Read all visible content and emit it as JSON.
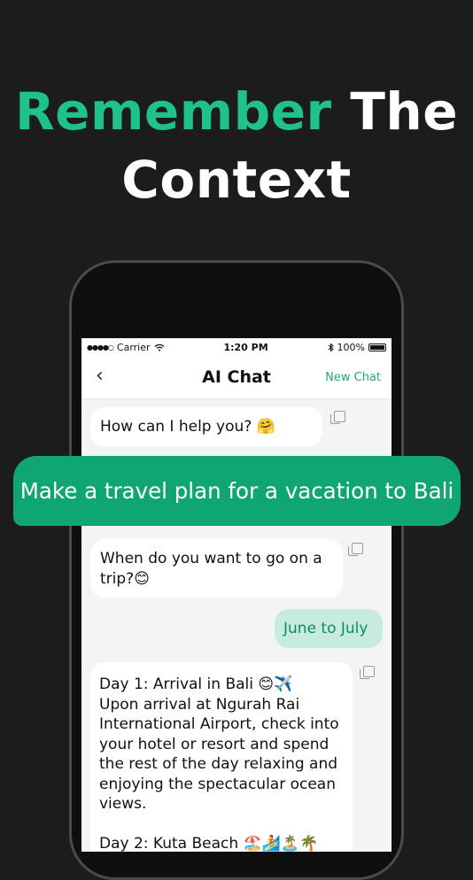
{
  "headline": {
    "accent": "Remember",
    "rest": " The",
    "line2": "Context"
  },
  "status": {
    "carrier": "Carrier",
    "time": "1:20 PM",
    "battery": "100%"
  },
  "nav": {
    "back": "‹",
    "title": "AI Chat",
    "new_chat": "New Chat"
  },
  "messages": [
    {
      "role": "assistant",
      "text": "How can I help you? 🤗"
    },
    {
      "role": "user",
      "text": "Make a travel plan for a vacation to Bali"
    },
    {
      "role": "assistant",
      "text": "When do you want to go on a trip?😊"
    },
    {
      "role": "user",
      "text": "June to July"
    },
    {
      "role": "assistant",
      "text": "Day 1: Arrival in Bali 😊✈️\nUpon arrival at Ngurah Rai International Airport, check into your hotel or resort and spend the rest of the day relaxing and enjoying the spectacular ocean views.\n\nDay 2: Kuta Beach 🏖️🏄🏝️🌴"
    }
  ],
  "icons": {
    "copy": "copy-icon",
    "back": "chevron-left-icon",
    "wifi": "wifi-icon",
    "bluetooth": "bluetooth-icon",
    "battery": "battery-icon"
  },
  "colors": {
    "accent": "#1fc28a",
    "overlay": "#0fa673",
    "user_bubble": "#c7ecdf",
    "user_text": "#0f8a62"
  }
}
